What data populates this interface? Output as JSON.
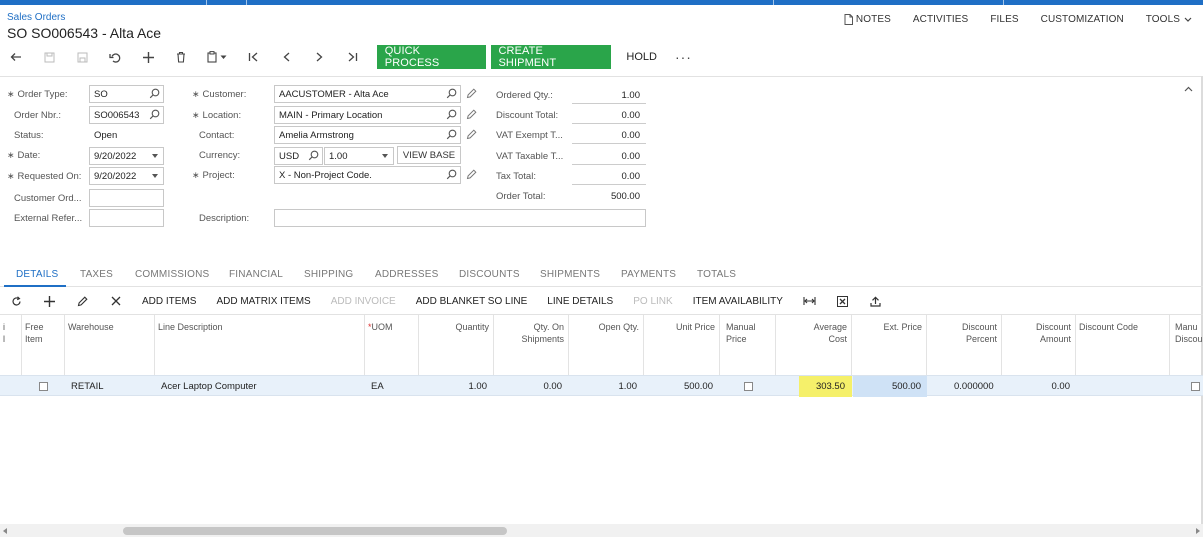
{
  "header": {
    "breadcrumb": "Sales Orders",
    "title": "SO SO006543 - Alta Ace",
    "menu": [
      "NOTES",
      "ACTIVITIES",
      "FILES",
      "CUSTOMIZATION",
      "TOOLS"
    ]
  },
  "toolbar": {
    "quick_process": "QUICK PROCESS",
    "create_shipment": "CREATE SHIPMENT",
    "hold": "HOLD",
    "more": "···"
  },
  "form": {
    "order_type": {
      "label": "Order Type:",
      "value": "SO"
    },
    "order_nbr": {
      "label": "Order Nbr.:",
      "value": "SO006543"
    },
    "status": {
      "label": "Status:",
      "value": "Open"
    },
    "date": {
      "label": "Date:",
      "value": "9/20/2022"
    },
    "requested_on": {
      "label": "Requested On:",
      "value": "9/20/2022"
    },
    "customer_order": {
      "label": "Customer Ord...",
      "value": ""
    },
    "external_ref": {
      "label": "External Refer...",
      "value": ""
    },
    "customer": {
      "label": "Customer:",
      "value": "AACUSTOMER - Alta Ace"
    },
    "location": {
      "label": "Location:",
      "value": "MAIN - Primary Location"
    },
    "contact": {
      "label": "Contact:",
      "value": "Amelia Armstrong"
    },
    "currency": {
      "label": "Currency:",
      "code": "USD",
      "rate": "1.00",
      "view_base": "VIEW BASE"
    },
    "project": {
      "label": "Project:",
      "value": "X - Non-Project Code."
    },
    "description": {
      "label": "Description:",
      "value": ""
    },
    "ordered_qty": {
      "label": "Ordered Qty.:",
      "value": "1.00"
    },
    "discount_total": {
      "label": "Discount Total:",
      "value": "0.00"
    },
    "vat_exempt": {
      "label": "VAT Exempt T...",
      "value": "0.00"
    },
    "vat_taxable": {
      "label": "VAT Taxable T...",
      "value": "0.00"
    },
    "tax_total": {
      "label": "Tax Total:",
      "value": "0.00"
    },
    "order_total": {
      "label": "Order Total:",
      "value": "500.00"
    }
  },
  "tabs": [
    "DETAILS",
    "TAXES",
    "COMMISSIONS",
    "FINANCIAL",
    "SHIPPING",
    "ADDRESSES",
    "DISCOUNTS",
    "SHIPMENTS",
    "PAYMENTS",
    "TOTALS"
  ],
  "grid_toolbar": {
    "add_items": "ADD ITEMS",
    "add_matrix_items": "ADD MATRIX ITEMS",
    "add_invoice": "ADD INVOICE",
    "add_blanket": "ADD BLANKET SO LINE",
    "line_details": "LINE DETAILS",
    "po_link": "PO LINK",
    "item_availability": "ITEM AVAILABILITY"
  },
  "grid": {
    "columns": {
      "c0": "i\nl",
      "free_item": "Free\nItem",
      "warehouse": "Warehouse",
      "line_description": "Line Description",
      "uom": "UOM",
      "quantity": "Quantity",
      "qty_on_shipments": "Qty. On\nShipments",
      "open_qty": "Open Qty.",
      "unit_price": "Unit Price",
      "manual_price": "Manual\nPrice",
      "average_cost": "Average\nCost",
      "ext_price": "Ext. Price",
      "discount_percent": "Discount\nPercent",
      "discount_amount": "Discount\nAmount",
      "discount_code": "Discount Code",
      "manual_discount": "Manu\nDiscou"
    },
    "rows": [
      {
        "warehouse": "RETAIL",
        "line_description": "Acer Laptop Computer",
        "uom": "EA",
        "quantity": "1.00",
        "qty_on_shipments": "0.00",
        "open_qty": "1.00",
        "unit_price": "500.00",
        "average_cost": "303.50",
        "ext_price": "500.00",
        "discount_percent": "0.000000",
        "discount_amount": "0.00"
      }
    ]
  }
}
